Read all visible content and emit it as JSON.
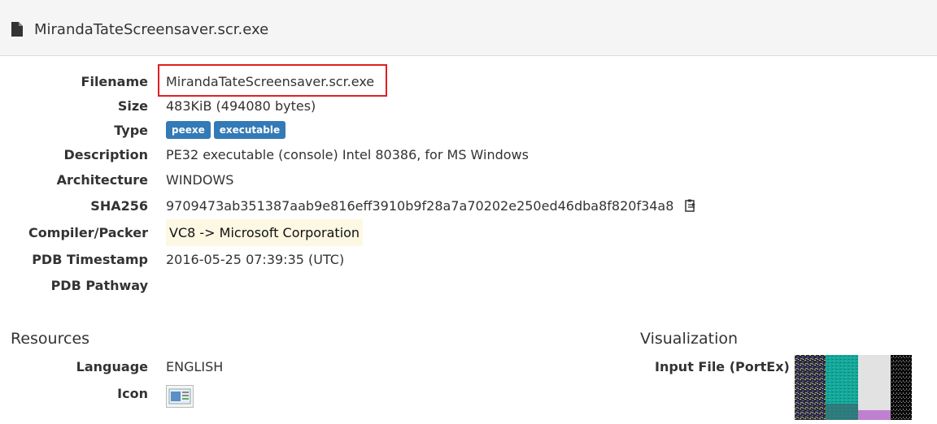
{
  "header": {
    "title": "MirandaTateScreensaver.scr.exe",
    "icon": "file-icon"
  },
  "details": {
    "filename_label": "Filename",
    "filename": "MirandaTateScreensaver.scr.exe",
    "size_label": "Size",
    "size": "483KiB (494080 bytes)",
    "type_label": "Type",
    "type_badges": [
      "peexe",
      "executable"
    ],
    "description_label": "Description",
    "description": "PE32 executable (console) Intel 80386, for MS Windows",
    "architecture_label": "Architecture",
    "architecture": "WINDOWS",
    "sha256_label": "SHA256",
    "sha256": "9709473ab351387aab9e816eff3910b9f28a7a70202e250ed46dba8f820f34a8",
    "compiler_label": "Compiler/Packer",
    "compiler": "VC8 -> Microsoft Corporation",
    "pdb_timestamp_label": "PDB Timestamp",
    "pdb_timestamp": "2016-05-25 07:39:35 (UTC)",
    "pdb_pathway_label": "PDB Pathway",
    "pdb_pathway": ""
  },
  "resources": {
    "title": "Resources",
    "language_label": "Language",
    "language": "ENGLISH",
    "icon_label": "Icon"
  },
  "visualization": {
    "title": "Visualization",
    "input_file_label": "Input File (PortEx)"
  },
  "colors": {
    "badge": "#337ab7",
    "highlight_border": "#e02020",
    "compiler_bg": "#fcf8e3"
  }
}
